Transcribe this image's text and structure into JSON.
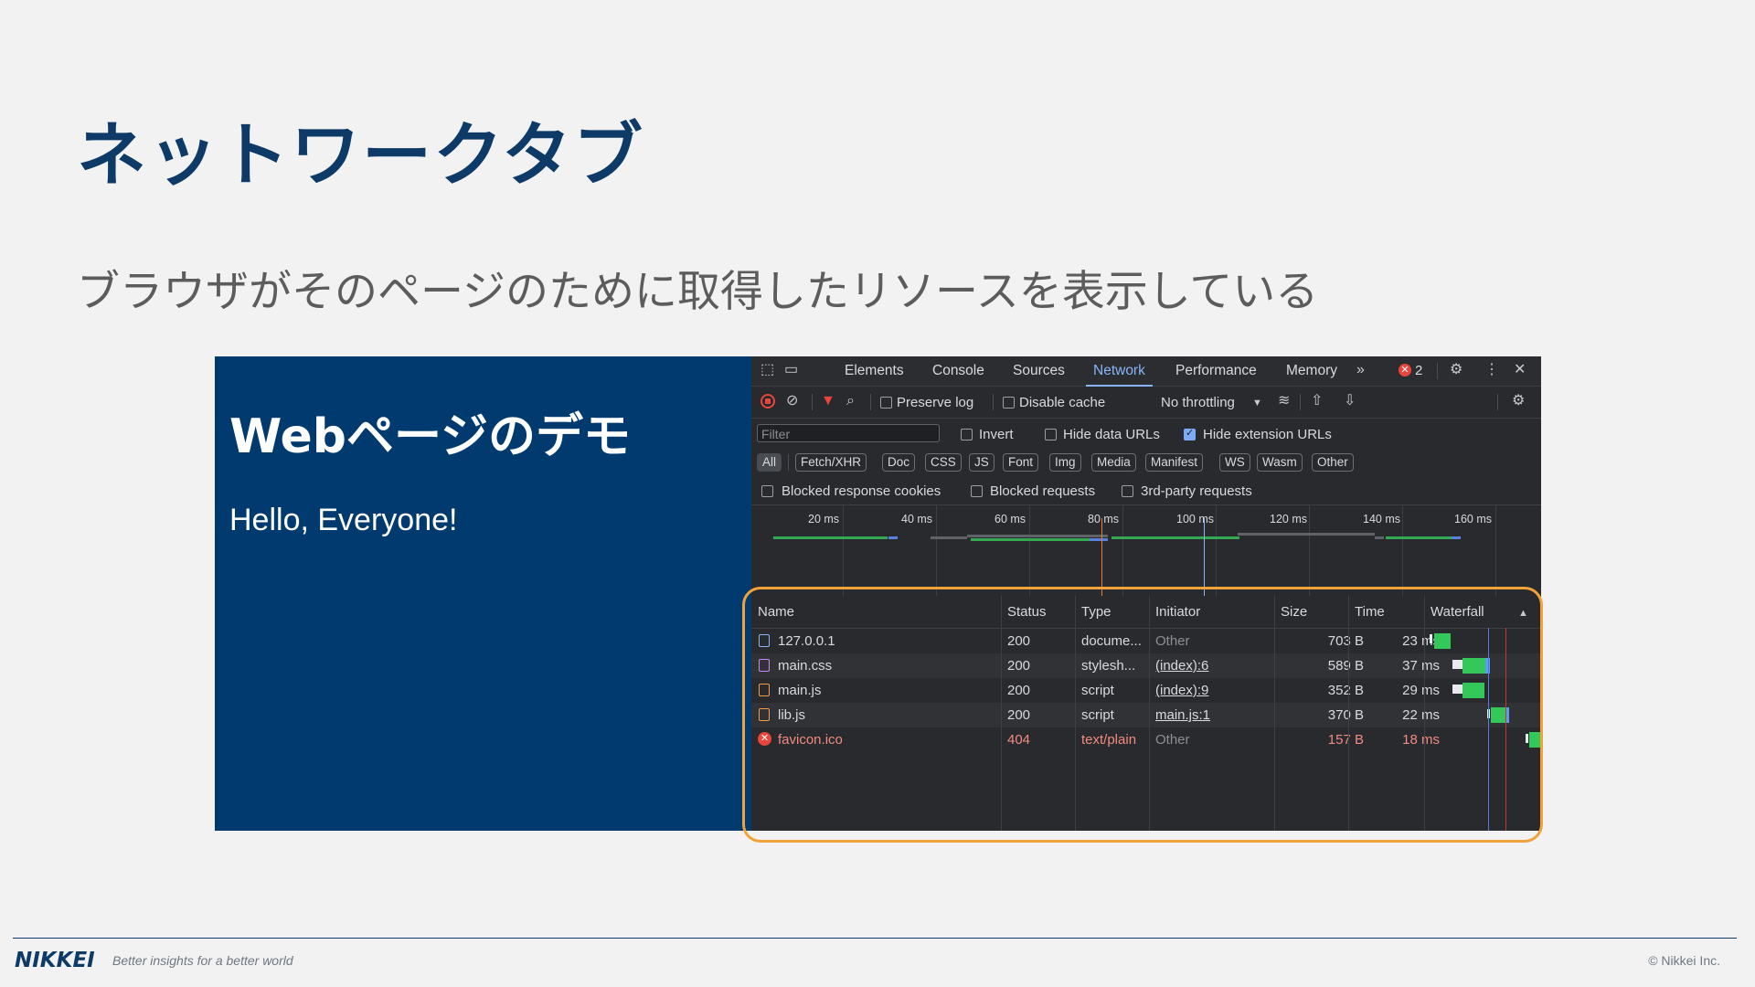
{
  "slide": {
    "title": "ネットワークタブ",
    "subtitle": "ブラウザがそのページのために取得したリソースを表示している"
  },
  "demo_page": {
    "heading": "Webページのデモ",
    "text": "Hello, Everyone!",
    "background": "#003a6e"
  },
  "devtools": {
    "tabs": [
      "Elements",
      "Console",
      "Sources",
      "Network",
      "Performance",
      "Memory"
    ],
    "active_tab": "Network",
    "error_count": "2",
    "toolbar": {
      "preserve_log": "Preserve log",
      "disable_cache": "Disable cache",
      "throttling": "No throttling"
    },
    "filter": {
      "placeholder": "Filter",
      "invert": "Invert",
      "hide_data_urls": "Hide data URLs",
      "hide_extension_urls": "Hide extension URLs",
      "hide_extension_urls_checked": true
    },
    "type_chips": [
      "All",
      "Fetch/XHR",
      "Doc",
      "CSS",
      "JS",
      "Font",
      "Img",
      "Media",
      "Manifest",
      "WS",
      "Wasm",
      "Other"
    ],
    "active_chip": "All",
    "checks": {
      "blocked_cookies": "Blocked response cookies",
      "blocked_requests": "Blocked requests",
      "third_party": "3rd-party requests"
    },
    "timeline_ticks": [
      "20 ms",
      "40 ms",
      "60 ms",
      "80 ms",
      "100 ms",
      "120 ms",
      "140 ms",
      "160 ms"
    ],
    "columns": {
      "name": "Name",
      "status": "Status",
      "type": "Type",
      "initiator": "Initiator",
      "size": "Size",
      "time": "Time",
      "waterfall": "Waterfall"
    },
    "requests": [
      {
        "name": "127.0.0.1",
        "status": "200",
        "type": "docume...",
        "initiator": "Other",
        "size": "703 B",
        "time": "23 ms",
        "icon": "document-icon"
      },
      {
        "name": "main.css",
        "status": "200",
        "type": "stylesh...",
        "initiator": "(index):6",
        "size": "589 B",
        "time": "37 ms",
        "icon": "stylesheet-icon"
      },
      {
        "name": "main.js",
        "status": "200",
        "type": "script",
        "initiator": "(index):9",
        "size": "352 B",
        "time": "29 ms",
        "icon": "script-icon"
      },
      {
        "name": "lib.js",
        "status": "200",
        "type": "script",
        "initiator": "main.js:1",
        "size": "370 B",
        "time": "22 ms",
        "icon": "script-icon"
      },
      {
        "name": "favicon.ico",
        "status": "404",
        "type": "text/plain",
        "initiator": "Other",
        "size": "157 B",
        "time": "18 ms",
        "icon": "error-icon"
      }
    ]
  },
  "footer": {
    "logo": "NIKKEI",
    "tagline": "Better insights for a better world",
    "copyright": "© Nikkei Inc."
  },
  "colors": {
    "title": "#0d3a66",
    "highlight": "#f0a33a",
    "devtools_bg": "#282a2e",
    "accent": "#8ab4f8",
    "error": "#f28b82"
  }
}
